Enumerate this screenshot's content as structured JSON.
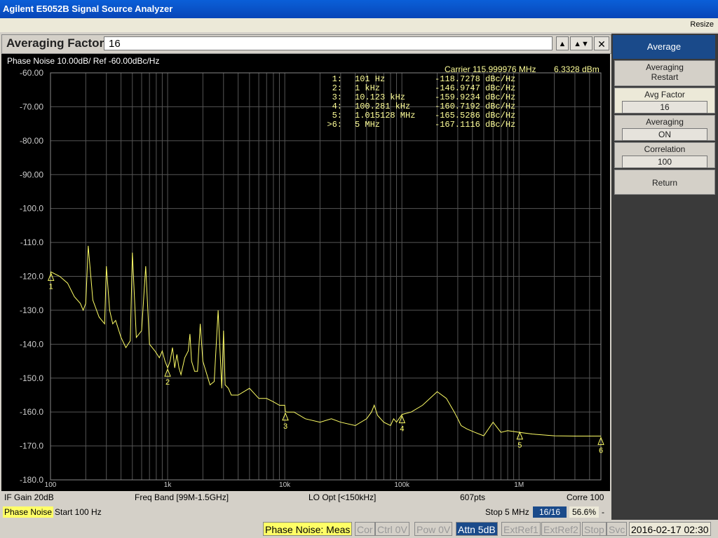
{
  "window": {
    "title": "Agilent E5052B Signal Source Analyzer",
    "resize_label": "Resize"
  },
  "entry": {
    "label": "Averaging Factor",
    "value": "16",
    "up": "▲",
    "updown": "▲▼",
    "close": "✕"
  },
  "softkeys": {
    "header": "Average",
    "items": [
      {
        "label": "Averaging",
        "label2": "Restart"
      },
      {
        "label": "Avg Factor",
        "value": "16"
      },
      {
        "label": "Averaging",
        "value": "ON"
      },
      {
        "label": "Correlation",
        "value": "100"
      },
      {
        "label": "Return"
      }
    ]
  },
  "trace": {
    "header": "Phase Noise 10.00dB/ Ref -60.00dBc/Hz",
    "carrier_label": "Carrier 115.999976 MHz",
    "carrier_power": "6.3328 dBm",
    "markers": [
      {
        "id": "1:",
        "freq": "101 Hz",
        "value": "-118.7278 dBc/Hz"
      },
      {
        "id": "2:",
        "freq": "1 kHz",
        "value": "-146.9747 dBc/Hz"
      },
      {
        "id": "3:",
        "freq": "10.123 kHz",
        "value": "-159.9234 dBc/Hz"
      },
      {
        "id": "4:",
        "freq": "100.281 kHz",
        "value": "-160.7192 dBc/Hz"
      },
      {
        "id": "5:",
        "freq": "1.015128 MHz",
        "value": "-165.5286 dBc/Hz"
      },
      {
        "id": ">6:",
        "freq": "5 MHz",
        "value": "-167.1116 dBc/Hz"
      }
    ]
  },
  "chart_data": {
    "type": "line",
    "xscale": "log",
    "xlim": [
      100,
      5000000
    ],
    "ylim": [
      -180,
      -60
    ],
    "y_ticks": [
      "-60.00",
      "-70.00",
      "-80.00",
      "-90.00",
      "-100.0",
      "-110.0",
      "-120.0",
      "-130.0",
      "-140.0",
      "-150.0",
      "-160.0",
      "-170.0",
      "-180.0"
    ],
    "x_tick_labels": [
      {
        "x": 100,
        "label": "100"
      },
      {
        "x": 1000,
        "label": "1k"
      },
      {
        "x": 10000,
        "label": "10k"
      },
      {
        "x": 100000,
        "label": "100k"
      },
      {
        "x": 1000000,
        "label": "1M"
      }
    ],
    "grid": true,
    "series": [
      {
        "color": "#ffff66",
        "x": [
          100,
          101,
          120,
          140,
          160,
          180,
          190,
          200,
          210,
          230,
          260,
          290,
          300,
          320,
          340,
          360,
          400,
          440,
          480,
          500,
          540,
          600,
          650,
          700,
          780,
          850,
          900,
          950,
          1000,
          1050,
          1100,
          1150,
          1200,
          1250,
          1300,
          1400,
          1500,
          1550,
          1600,
          1700,
          1800,
          1900,
          2000,
          2300,
          2500,
          2700,
          2900,
          3000,
          3100,
          3300,
          3500,
          4000,
          5000,
          6000,
          7000,
          8000,
          9000,
          10000,
          10123,
          10500,
          12000,
          15000,
          20000,
          25000,
          30000,
          40000,
          50000,
          55000,
          58000,
          62000,
          70000,
          80000,
          85000,
          90000,
          100281,
          120000,
          150000,
          200000,
          240000,
          280000,
          300000,
          320000,
          360000,
          420000,
          500000,
          600000,
          700000,
          800000,
          1015128,
          1300000,
          2000000,
          3000000,
          4000000,
          5000000
        ],
        "y": [
          -120,
          -118.7,
          -120,
          -122,
          -126,
          -128,
          -130,
          -128,
          -111,
          -127,
          -132,
          -134,
          -117,
          -130,
          -134,
          -133,
          -138,
          -141,
          -139,
          -113,
          -138,
          -136,
          -117,
          -140,
          -142,
          -144,
          -142,
          -145,
          -147,
          -145,
          -141,
          -147,
          -143,
          -147,
          -149,
          -144,
          -142,
          -137,
          -145,
          -148,
          -148,
          -134,
          -145,
          -152,
          -151,
          -130,
          -153,
          -136,
          -152,
          -153,
          -155,
          -155,
          -153,
          -156,
          -156,
          -157,
          -158,
          -158,
          -159.9,
          -160,
          -160,
          -162,
          -163,
          -162,
          -163,
          -164,
          -162,
          -160,
          -158,
          -161,
          -163,
          -164,
          -162,
          -163,
          -160.7,
          -160,
          -158,
          -154,
          -156,
          -160,
          -162,
          -164,
          -165,
          -166,
          -167,
          -163,
          -166,
          -165.5,
          -166,
          -166.5,
          -167,
          -167.1,
          -167.1,
          -167.1
        ]
      }
    ],
    "markers": [
      {
        "label": "1",
        "x": 101,
        "y": -118.7278
      },
      {
        "label": "2",
        "x": 1000,
        "y": -146.9747
      },
      {
        "label": "3",
        "x": 10123,
        "y": -159.9234
      },
      {
        "label": "4",
        "x": 100281,
        "y": -160.7192
      },
      {
        "label": "5",
        "x": 1015128,
        "y": -165.5286
      },
      {
        "label": "6",
        "x": 5000000,
        "y": -167.1116
      }
    ]
  },
  "status1": {
    "if_gain": "IF Gain 20dB",
    "freq_band": "Freq Band [99M-1.5GHz]",
    "lo_opt": "LO Opt [<150kHz]",
    "points": "607pts",
    "corre": "Corre 100"
  },
  "status2": {
    "meas": "Phase Noise",
    "start": "Start 100 Hz",
    "stop": "Stop 5 MHz",
    "avg": "16/16",
    "pct": "56.6%",
    "dash": "-"
  },
  "bottom": {
    "meas": "Phase Noise: Meas",
    "cor": "Cor",
    "ctrl": "Ctrl 0V",
    "pow": "Pow 0V",
    "attn": "Attn 5dB",
    "extref1": "ExtRef1",
    "extref2": "ExtRef2",
    "stop": "Stop",
    "svc": "Svc",
    "datetime": "2016-02-17 02:30"
  },
  "colors": {
    "trace": "#ffff66",
    "grid": "#555555",
    "screen_bg": "#000000",
    "meas_highlight": "#ffff66"
  }
}
